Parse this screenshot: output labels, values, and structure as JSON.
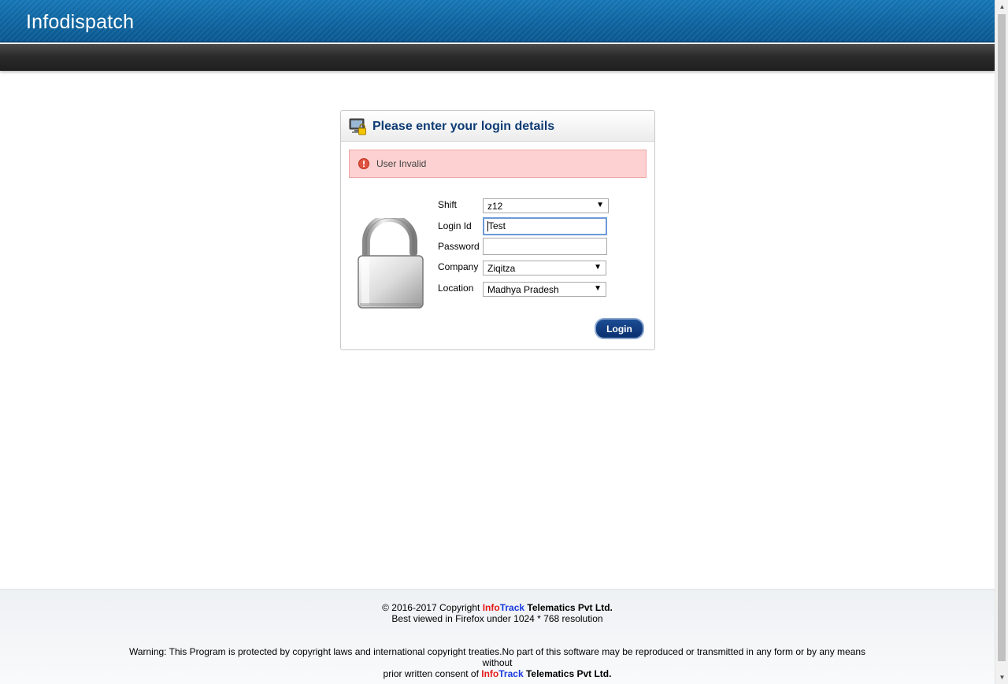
{
  "header": {
    "app_title": "Infodispatch"
  },
  "login_panel": {
    "title": "Please enter your login details",
    "error_message": "User Invalid",
    "fields": {
      "shift": {
        "label": "Shift",
        "value": "z12"
      },
      "login_id": {
        "label": "Login Id",
        "value": "Test",
        "placeholder": ""
      },
      "password": {
        "label": "Password",
        "value": "",
        "placeholder": ""
      },
      "company": {
        "label": "Company",
        "value": "Ziqitza"
      },
      "location": {
        "label": "Location",
        "value": "Madhya Pradesh"
      }
    },
    "login_button": "Login"
  },
  "footer": {
    "copyright_prefix": "© 2016-2017 Copyright",
    "brand_info": "Info",
    "brand_track": "Track",
    "brand_rest": "Telematics Pvt Ltd.",
    "best_viewed": "Best viewed in Firefox under 1024 * 768 resolution",
    "warning_line1": "Warning: This Program is protected by copyright laws and international copyright treaties.No part of this software may be reproduced or transmitted in any form or by any means without",
    "warning_prefix2": "prior written consent of"
  },
  "icons": {
    "header_icon": "monitor-lock-icon",
    "error_icon": "exclamation-circle-icon",
    "lock_image": "open-padlock-icon",
    "dropdown_arrow": "triangle-down-icon"
  },
  "colors": {
    "header_blue": "#1778b8",
    "panel_title": "#0f3c74",
    "error_bg": "#fdd1d1",
    "login_button": "#0a2f6e",
    "brand_red": "#e51b1b",
    "brand_blue": "#1a3ae0"
  }
}
